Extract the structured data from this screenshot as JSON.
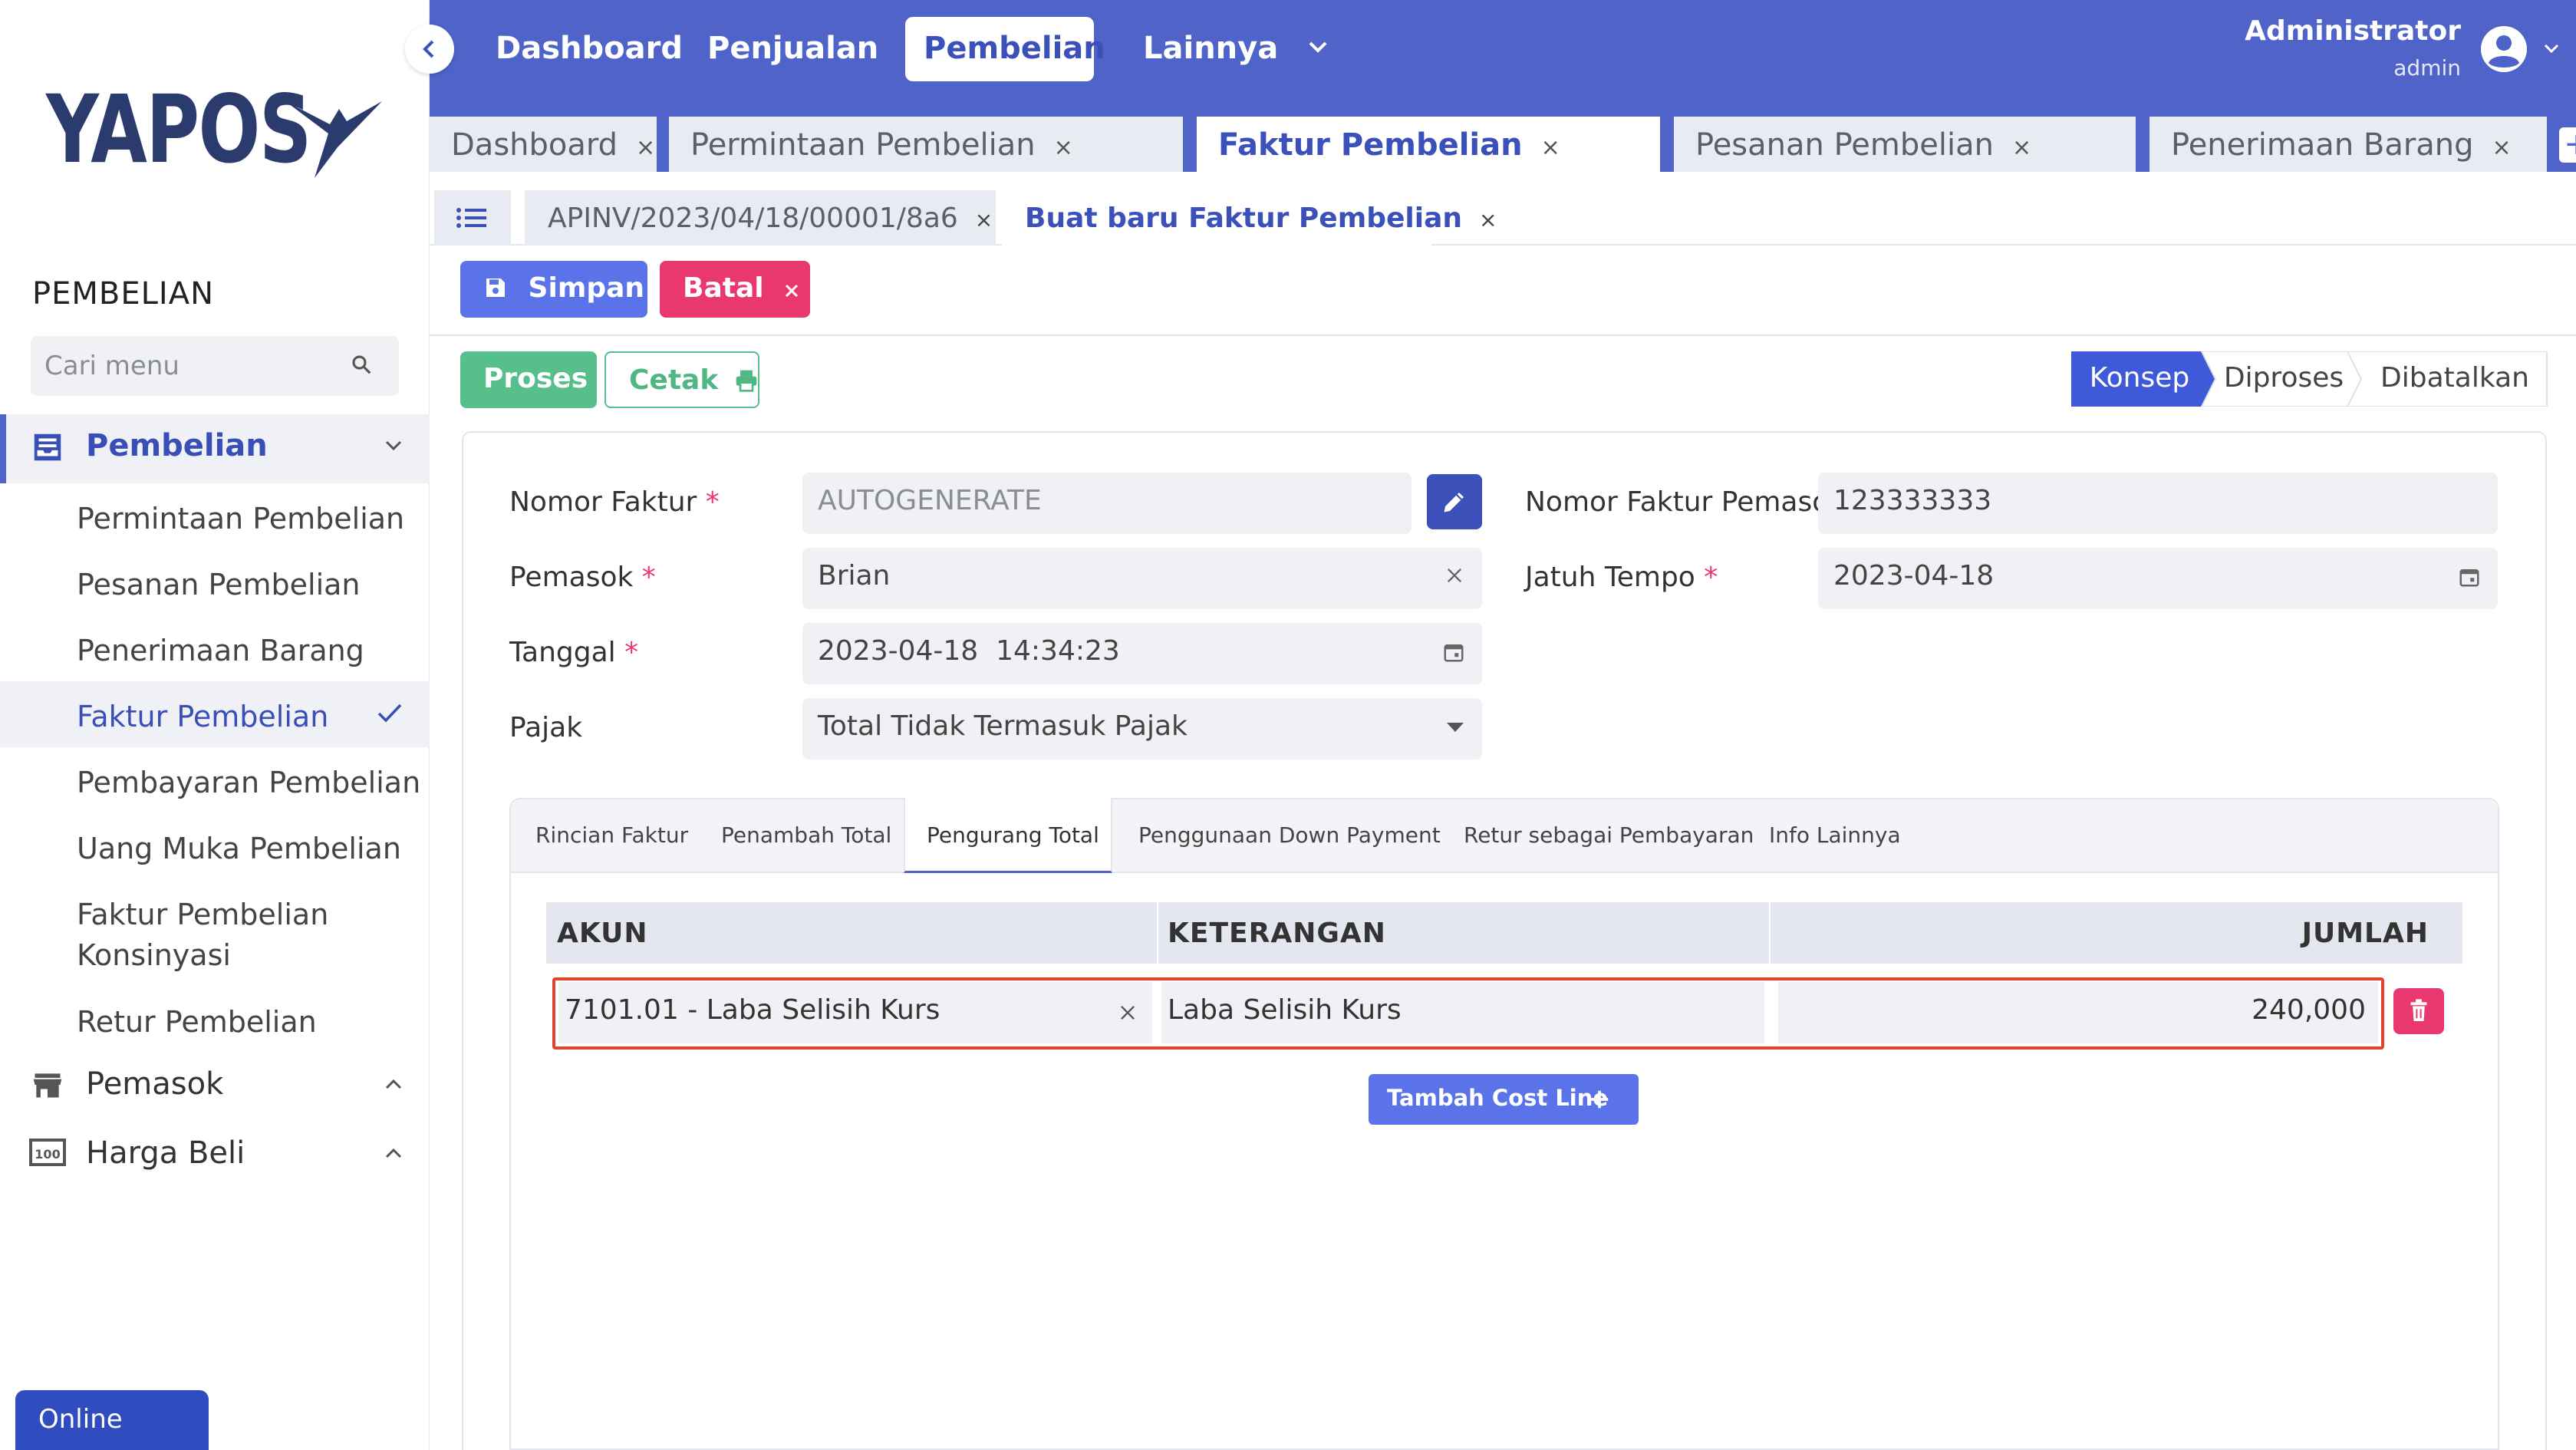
{
  "brand": {
    "name": "YAPOS"
  },
  "sidebar": {
    "section_title": "PEMBELIAN",
    "search_placeholder": "Cari menu",
    "groups": [
      {
        "label": "Pembelian",
        "icon": "inbox-tray-icon",
        "expanded": true
      },
      {
        "label": "Pemasok",
        "icon": "store-icon",
        "expanded": false
      },
      {
        "label": "Harga Beli",
        "icon": "price-tag-icon",
        "expanded": false
      }
    ],
    "items": [
      {
        "label": "Permintaan Pembelian"
      },
      {
        "label": "Pesanan Pembelian"
      },
      {
        "label": "Penerimaan Barang"
      },
      {
        "label": "Faktur Pembelian",
        "active": true
      },
      {
        "label": "Pembayaran Pembelian"
      },
      {
        "label": "Uang Muka Pembelian"
      },
      {
        "label": "Faktur Pembelian Konsinyasi"
      },
      {
        "label": "Retur Pembelian"
      }
    ],
    "status": "Online"
  },
  "topnav": {
    "items": [
      "Dashboard",
      "Penjualan",
      "Pembelian",
      "Lainnya"
    ],
    "active": "Pembelian",
    "user_name": "Administrator",
    "user_role": "admin"
  },
  "tabs": {
    "items": [
      "Dashboard",
      "Permintaan Pembelian",
      "Faktur Pembelian",
      "Pesanan Pembelian",
      "Penerimaan Barang"
    ],
    "active": "Faktur Pembelian",
    "close_glyph": "×",
    "add_glyph": "+"
  },
  "subtabs": {
    "items": [
      "APINV/2023/04/18/00001/8a6",
      "Buat baru Faktur Pembelian"
    ],
    "active": "Buat baru Faktur Pembelian"
  },
  "actions": {
    "save": "Simpan",
    "cancel": "Batal",
    "process": "Proses",
    "print": "Cetak"
  },
  "status_steps": {
    "items": [
      "Konsep",
      "Diproses",
      "Dibatalkan"
    ],
    "active": "Konsep"
  },
  "form": {
    "invoice_number": {
      "label": "Nomor Faktur",
      "placeholder": "AUTOGENERATE"
    },
    "supplier": {
      "label": "Pemasok",
      "value": "Brian"
    },
    "date": {
      "label": "Tanggal",
      "value": "2023-04-18  14:34:23"
    },
    "tax": {
      "label": "Pajak",
      "value": "Total Tidak Termasuk Pajak"
    },
    "supplier_invoice_number": {
      "label": "Nomor Faktur Pemasok",
      "value": "123333333"
    },
    "due_date": {
      "label": "Jatuh Tempo",
      "value": "2023-04-18"
    },
    "required_mark": "*"
  },
  "detail_tabs": {
    "items": [
      "Rincian Faktur",
      "Penambah Total",
      "Pengurang Total",
      "Penggunaan Down Payment",
      "Retur sebagai Pembayaran",
      "Info Lainnya"
    ],
    "active": "Pengurang Total"
  },
  "cost_table": {
    "columns": [
      "AKUN",
      "KETERANGAN",
      "JUMLAH"
    ],
    "rows": [
      {
        "account": "7101.01 - Laba Selisih Kurs",
        "description": "Laba Selisih Kurs",
        "amount": "240,000"
      }
    ],
    "add_button": "Tambah Cost Line"
  },
  "colors": {
    "primary": "#4f63c8",
    "save": "#5b73e8",
    "danger": "#e8386f",
    "success": "#56bf8a",
    "highlight": "#e0462f"
  }
}
